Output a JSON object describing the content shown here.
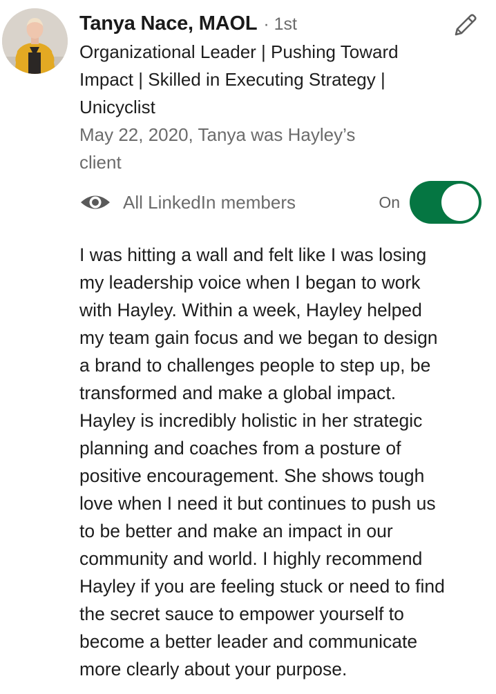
{
  "recommendation": {
    "author_name": "Tanya Nace, MAOL",
    "connection_degree": "· 1st",
    "headline_lines": [
      "Organizational Leader | Pushing Toward",
      "Impact | Skilled in Executing Strategy |",
      "Unicyclist"
    ],
    "meta_lines": [
      "May 22, 2020, Tanya was Hayley’s",
      "client"
    ],
    "edit_icon": "pencil-icon",
    "avatar_icon": "avatar",
    "visibility": {
      "icon": "eye-icon",
      "label": "All LinkedIn members",
      "state_label": "On",
      "enabled": true,
      "accent_color": "#057642"
    },
    "body_lines": [
      "I was hitting a wall and felt like I was losing",
      "my leadership voice when I began to work",
      "with Hayley. Within a week, Hayley helped",
      "my team gain focus and we began to design",
      "a brand to challenges people to step up, be",
      "transformed and make a global impact.",
      "Hayley is incredibly holistic in her strategic",
      "planning and coaches from a posture of",
      "positive encouragement. She shows tough",
      "love when I need it but continues to push us",
      "to be better and make an impact in our",
      "community and world. I highly recommend",
      "Hayley if you are feeling stuck or need to find",
      "the secret sauce to empower yourself to",
      "become a better leader and communicate",
      "more clearly about your purpose."
    ]
  }
}
